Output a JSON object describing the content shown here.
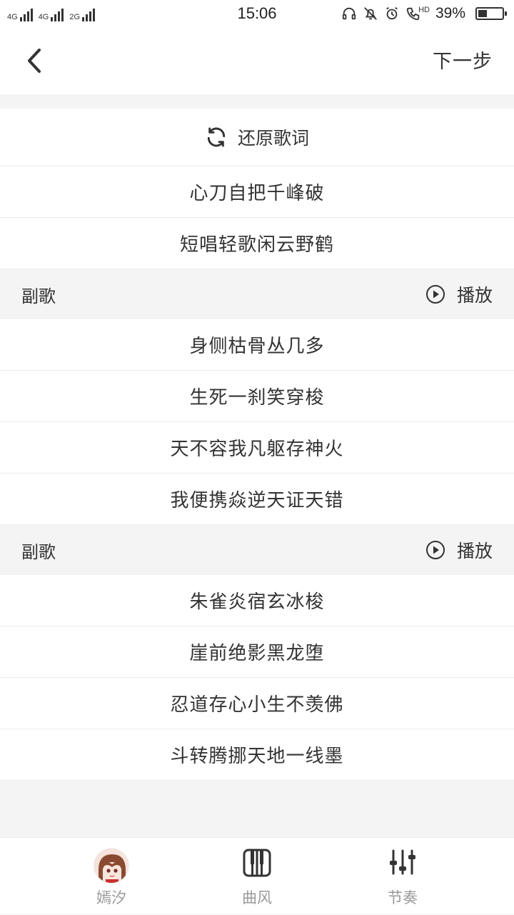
{
  "status_bar": {
    "signal1_label": "4G",
    "signal2_label": "4G",
    "signal3_label": "2G",
    "time": "15:06",
    "hd_label": "HD",
    "battery_pct": "39%",
    "battery_level": 0.39
  },
  "header": {
    "next_label": "下一步"
  },
  "restore": {
    "label": "还原歌词"
  },
  "verse1": [
    "心刀自把千峰破",
    "短唱轻歌闲云野鹤"
  ],
  "section1": {
    "label": "副歌",
    "play_label": "播放"
  },
  "chorus1": [
    "身侧枯骨丛几多",
    "生死一刹笑穿梭",
    "天不容我凡躯存神火",
    "我便携焱逆天证天错"
  ],
  "section2": {
    "label": "副歌",
    "play_label": "播放"
  },
  "chorus2": [
    "朱雀炎宿玄冰梭",
    "崖前绝影黑龙堕",
    "忍道存心小生不羡佛",
    "斗转腾挪天地一线墨"
  ],
  "bottom_nav": {
    "items": [
      {
        "label": "嫣汐",
        "icon": "avatar"
      },
      {
        "label": "曲风",
        "icon": "piano-icon"
      },
      {
        "label": "节奏",
        "icon": "sliders-icon"
      }
    ]
  },
  "colors": {
    "background": "#f4f4f4",
    "text": "#333333",
    "nav_text": "#999999"
  }
}
